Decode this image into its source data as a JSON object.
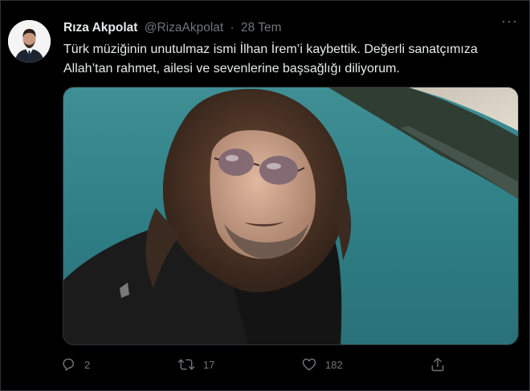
{
  "tweet": {
    "author_name": "Rıza Akpolat",
    "author_handle": "@RizaAkpolat",
    "separator": "·",
    "timestamp": "28 Tem",
    "more_label": "···",
    "text_line1": "Türk müziğinin unutulmaz ismi İlhan İrem’i kaybettik. Değerli sanatçımıza",
    "text_line2": "Allah’tan rahmet, ailesi ve sevenlerine başsağlığı diliyorum."
  },
  "actions": {
    "reply_count": "2",
    "retweet_count": "17",
    "like_count": "182"
  },
  "colors": {
    "background": "#000000",
    "text": "#e7e9ea",
    "secondary": "#71767b",
    "border": "#2f3336"
  }
}
